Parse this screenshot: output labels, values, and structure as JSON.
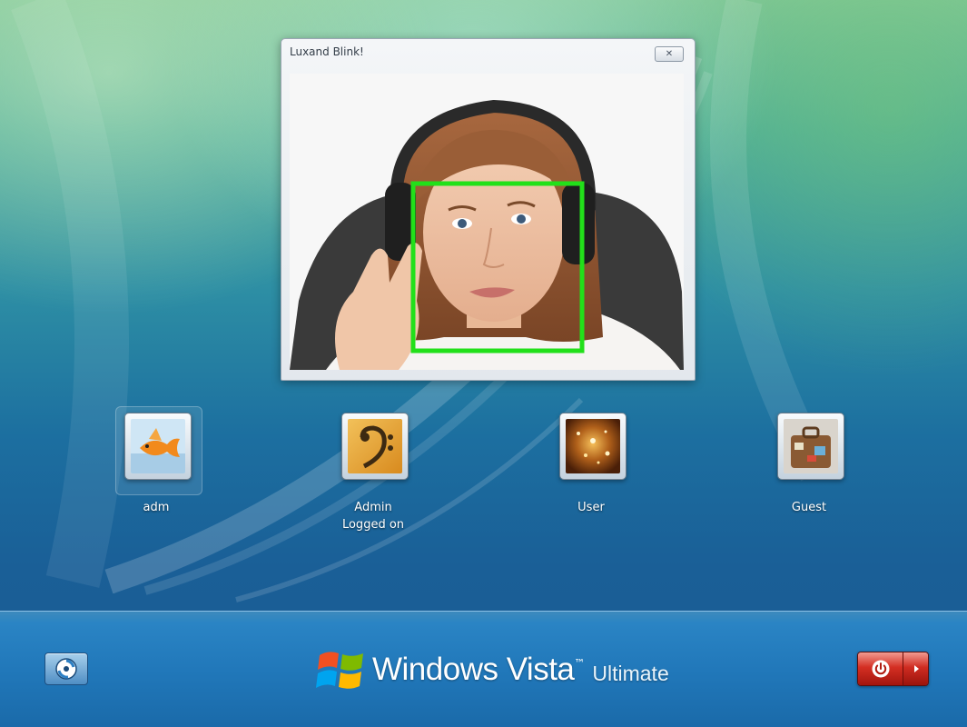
{
  "login_window": {
    "title": "Luxand Blink!",
    "close_icon": "close-icon",
    "face_box_color": "#22e01a"
  },
  "users": [
    {
      "name": "adm",
      "status": "",
      "picture": "goldfish",
      "selected": true
    },
    {
      "name": "Admin",
      "status": "Logged on",
      "picture": "bass-clef",
      "selected": false
    },
    {
      "name": "User",
      "status": "",
      "picture": "sparkles",
      "selected": false
    },
    {
      "name": "Guest",
      "status": "",
      "picture": "suitcase",
      "selected": false
    }
  ],
  "bottom_bar": {
    "ease_of_access_icon": "ease-of-access-icon",
    "brand_name": "Windows Vista",
    "brand_trademark": "™",
    "brand_edition": "Ultimate",
    "shutdown_icon": "power-icon",
    "shutdown_options_icon": "arrow-right-icon",
    "shutdown_color": "#c8261b"
  }
}
